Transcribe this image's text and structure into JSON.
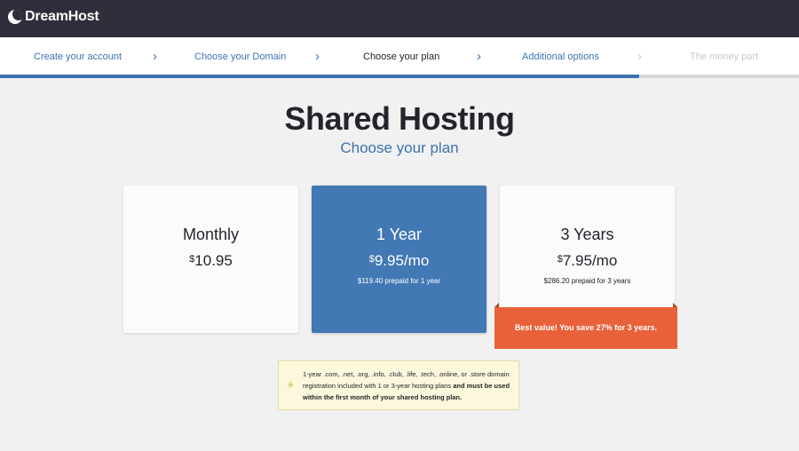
{
  "brand": {
    "name": "DreamHost"
  },
  "steps": [
    {
      "label": "Create your account",
      "state": "completed"
    },
    {
      "label": "Choose your Domain",
      "state": "completed"
    },
    {
      "label": "Choose your plan",
      "state": "current"
    },
    {
      "label": "Additional options",
      "state": "upcoming"
    },
    {
      "label": "The money part",
      "state": "disabled"
    }
  ],
  "progress": {
    "percent": 80
  },
  "page": {
    "title": "Shared Hosting",
    "subtitle": "Choose your plan"
  },
  "plans": [
    {
      "name": "Monthly",
      "currency": "$",
      "price": "10.95",
      "per": "",
      "note": "",
      "selected": false
    },
    {
      "name": "1 Year",
      "currency": "$",
      "price": "9.95",
      "per": "/mo",
      "note": "$119.40 prepaid for 1 year",
      "selected": true
    },
    {
      "name": "3 Years",
      "currency": "$",
      "price": "7.95",
      "per": "/mo",
      "note": "$286.20 prepaid for 3 years",
      "selected": false
    }
  ],
  "best_value": {
    "text": "Best value! You save 27% for 3 years."
  },
  "notice": {
    "icon": "star-icon",
    "text": "1-year .com, .net, .org, .info, .club, .life, .tech, .online, or .store domain registration included with 1 or 3-year hosting plans ",
    "bold_text": "and must be used within the first month of your shared hosting plan."
  },
  "colors": {
    "accent": "#3a73b0",
    "selected_card": "#4278b4",
    "best_value": "#e8613a",
    "topbar": "#2e2f3a"
  }
}
